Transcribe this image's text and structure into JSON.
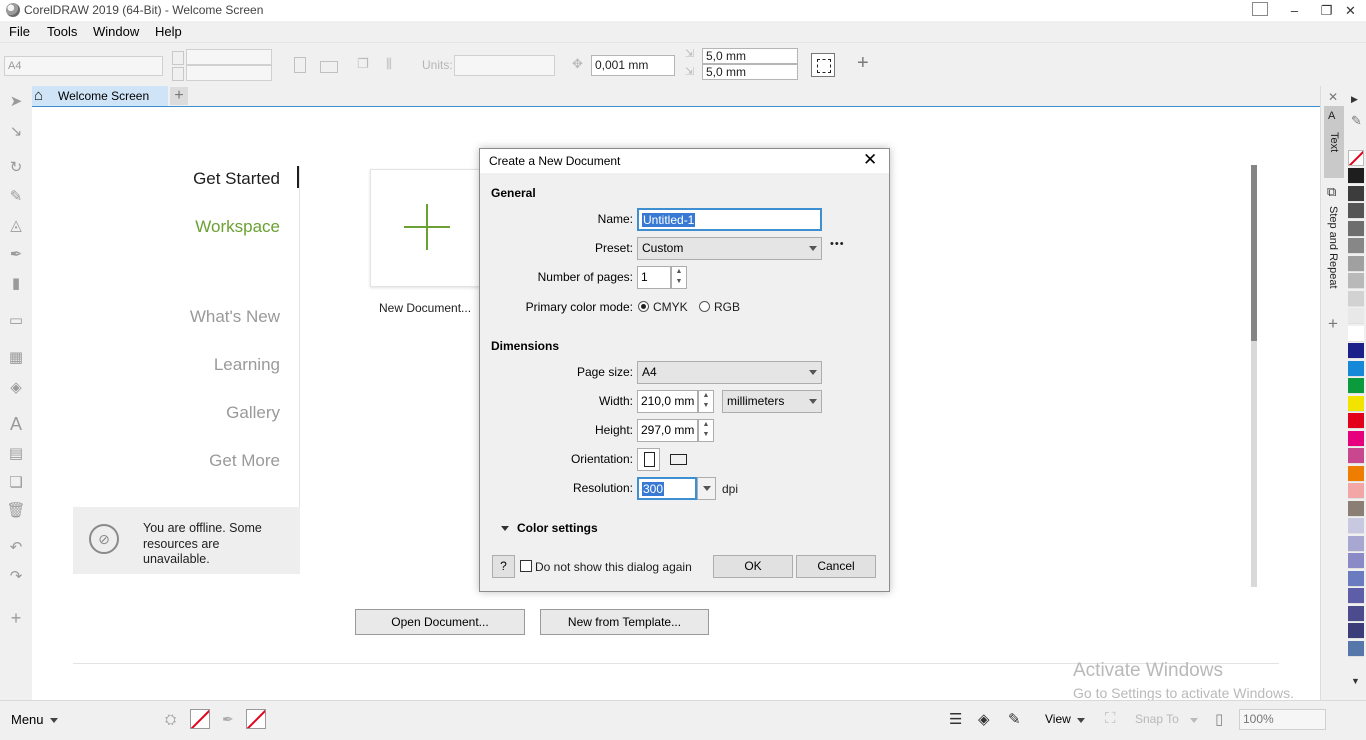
{
  "window": {
    "title": "CorelDRAW 2019 (64-Bit) - Welcome Screen",
    "controls": [
      "–",
      "❐",
      "✕"
    ]
  },
  "menu": [
    "File",
    "Tools",
    "Window",
    "Help"
  ],
  "propbar": {
    "page_size": "A4",
    "units_label": "Units:",
    "nudge": "0,001 mm",
    "dup_x": "5,0 mm",
    "dup_y": "5,0 mm",
    "add_glyph": "+"
  },
  "tabs": {
    "welcome": "Welcome Screen",
    "add": "+"
  },
  "welcome": {
    "nav": {
      "get_started": "Get Started",
      "workspace": "Workspace",
      "whats_new": "What's New",
      "learning": "Learning",
      "gallery": "Gallery",
      "get_more": "Get More"
    },
    "new_document_label": "New Document...",
    "offline_message": "You are offline. Some resources are unavailable.",
    "open_document": "Open Document...",
    "new_from_template": "New from Template...",
    "accent_color": "#6aa132"
  },
  "watermark": {
    "title": "Activate Windows",
    "subtitle": "Go to Settings to activate Windows."
  },
  "dockers": {
    "text": "Text",
    "step_repeat": "Step and Repeat"
  },
  "palette": [
    "#1e1e1e",
    "#3c3c3c",
    "#555555",
    "#6e6e6e",
    "#878787",
    "#a0a0a0",
    "#b9b9b9",
    "#d2d2d2",
    "#e8e8e8",
    "#ffffff",
    "#1b1f8a",
    "#1589d8",
    "#0b9a3c",
    "#f3e300",
    "#e2001a",
    "#e6007e",
    "#c9478f",
    "#ee7d00",
    "#f3a6a6",
    "#8b7e74",
    "#c8c8e0",
    "#a7a7d2",
    "#8a8ac6",
    "#6a7bc0",
    "#5e5ea8",
    "#4b4b8e",
    "#3c3c78",
    "#5577aa"
  ],
  "statusbar": {
    "menu": "Menu",
    "view": "View",
    "snap_to": "Snap To",
    "zoom": "100%"
  },
  "dialog": {
    "title": "Create a New Document",
    "general": "General",
    "name_label": "Name:",
    "name_value": "Untitled-1",
    "preset_label": "Preset:",
    "preset_value": "Custom",
    "more": "•••",
    "pages_label": "Number of pages:",
    "pages_value": "1",
    "color_mode_label": "Primary color mode:",
    "cmyk": "CMYK",
    "rgb": "RGB",
    "dimensions": "Dimensions",
    "page_size_label": "Page size:",
    "page_size_value": "A4",
    "width_label": "Width:",
    "width_value": "210,0 mm",
    "units_value": "millimeters",
    "height_label": "Height:",
    "height_value": "297,0 mm",
    "orientation_label": "Orientation:",
    "resolution_label": "Resolution:",
    "resolution_value": "300",
    "dpi": "dpi",
    "color_settings": "Color settings",
    "help": "?",
    "dont_show": "Do not show this dialog again",
    "ok": "OK",
    "cancel": "Cancel"
  }
}
